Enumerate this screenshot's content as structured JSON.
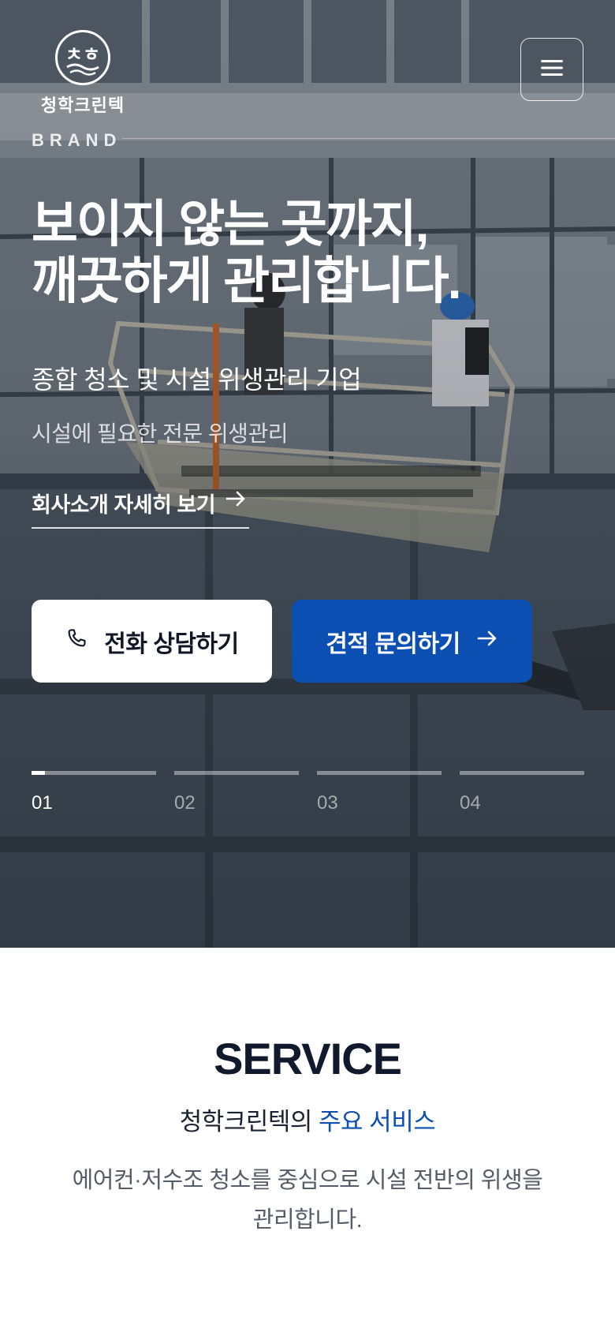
{
  "header": {
    "logo_text": "청학크린텍",
    "menu_icon": "hamburger-icon"
  },
  "hero": {
    "section_label": "BRAND",
    "headline_line1": "보이지 않는 곳까지,",
    "headline_line2": "깨끗하게 관리합니다.",
    "subhead": "종합 청소 및 시설 위생관리 기업",
    "subtext": "시설에 필요한 전문 위생관리",
    "about_link": "회사소개 자세히 보기",
    "phone_button": "전화 상담하기",
    "quote_button": "견적 문의하기",
    "slides": [
      "01",
      "02",
      "03",
      "04"
    ],
    "active_slide": 0,
    "active_progress": 0.11
  },
  "service": {
    "title": "SERVICE",
    "subtitle_prefix": "청학크린텍의",
    "subtitle_highlight": "주요 서비스",
    "description": "에어컨·저수조 청소를 중심으로 시설 전반의 위생을 관리합니다."
  },
  "colors": {
    "accent": "#0b4fb3",
    "dark_text": "#111a2c"
  }
}
